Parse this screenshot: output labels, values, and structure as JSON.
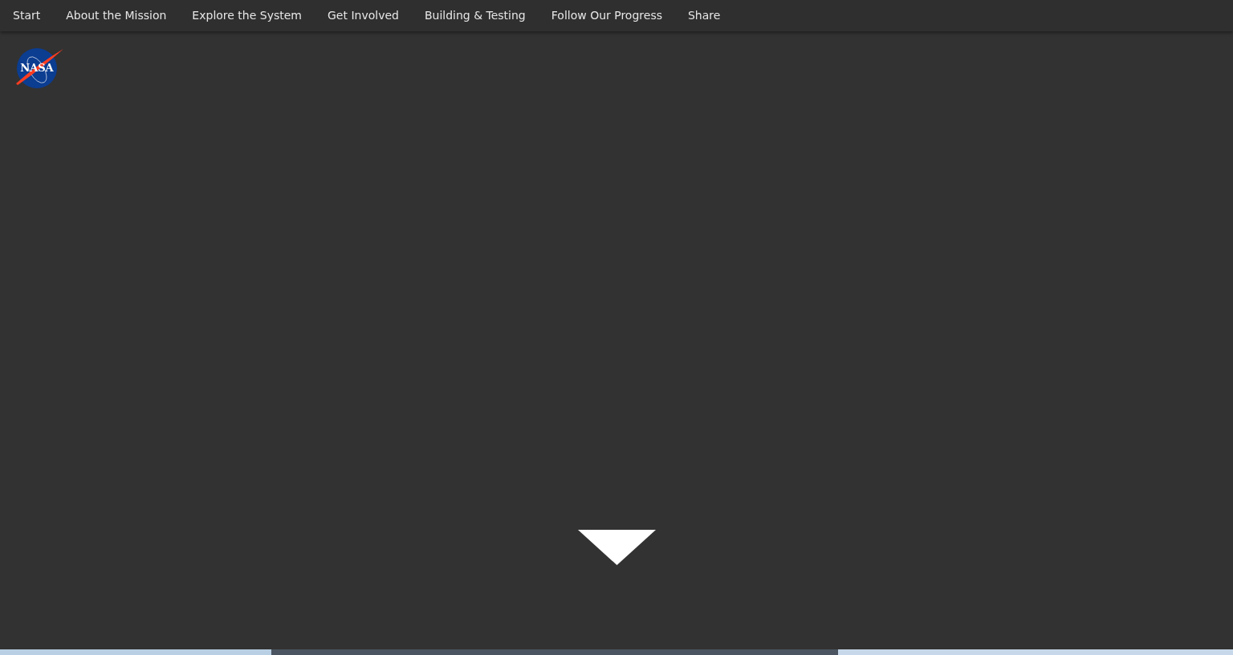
{
  "nav": {
    "items": [
      {
        "label": "Start",
        "selected": false
      },
      {
        "label": "About the Mission",
        "selected": false
      },
      {
        "label": "Explore the System",
        "selected": false
      },
      {
        "label": "Get Involved",
        "selected": false
      },
      {
        "label": "Building & Testing",
        "selected": false
      },
      {
        "label": "Follow Our Progress",
        "selected": false
      },
      {
        "label": "Share",
        "selected": false
      }
    ]
  },
  "logo": {
    "text": "NASA"
  }
}
